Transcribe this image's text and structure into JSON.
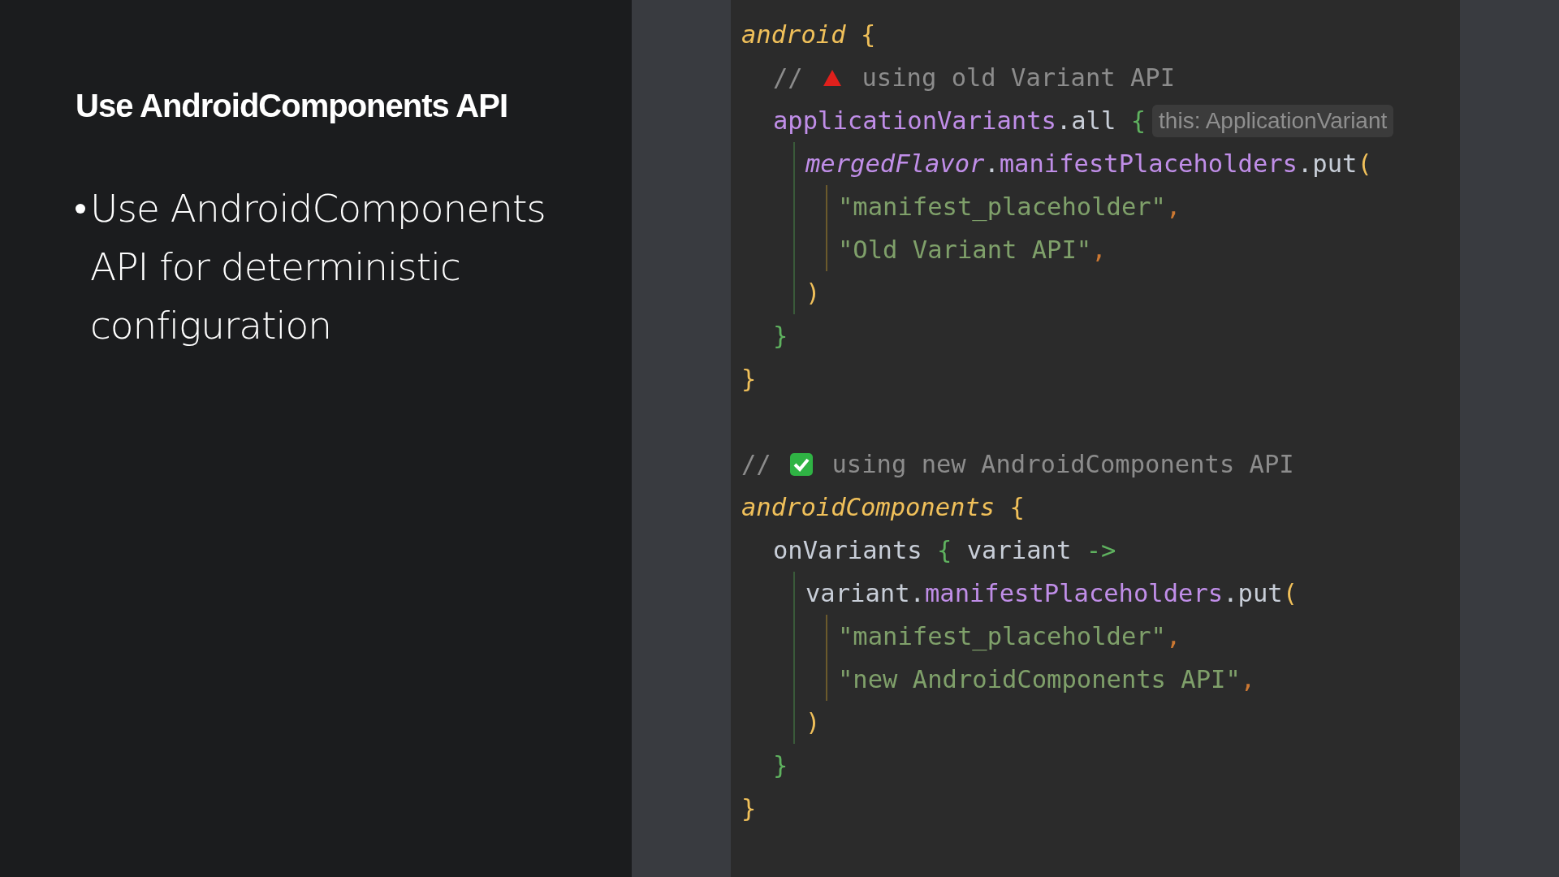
{
  "slide": {
    "title": "Use AndroidComponents API",
    "bullets": [
      "Use AndroidComponents API for deterministic configuration"
    ]
  },
  "code": {
    "blocks": [
      [
        {
          "tokens": [
            {
              "kind": "keyword",
              "text": "android"
            },
            {
              "kind": "brace",
              "text": " {"
            }
          ],
          "children": [
            {
              "tokens": [
                {
                  "kind": "comment",
                  "text": "// "
                },
                {
                  "kind": "triangle-icon"
                },
                {
                  "kind": "comment",
                  "text": " using old Variant API"
                }
              ]
            },
            {
              "tokens": [
                {
                  "kind": "property",
                  "text": "applicationVariants"
                },
                {
                  "kind": "plain",
                  "text": ".all "
                },
                {
                  "kind": "lambda",
                  "text": "{"
                },
                {
                  "kind": "hint",
                  "text": "this: ApplicationVariant"
                }
              ],
              "children": [
                {
                  "tokens": [
                    {
                      "kind": "italic-property",
                      "text": "mergedFlavor"
                    },
                    {
                      "kind": "plain",
                      "text": "."
                    },
                    {
                      "kind": "property",
                      "text": "manifestPlaceholders"
                    },
                    {
                      "kind": "plain",
                      "text": ".put"
                    },
                    {
                      "kind": "brace",
                      "text": "("
                    }
                  ],
                  "children": [
                    {
                      "tokens": [
                        {
                          "kind": "string",
                          "text": "\"manifest_placeholder\""
                        },
                        {
                          "kind": "comma",
                          "text": ","
                        }
                      ]
                    },
                    {
                      "tokens": [
                        {
                          "kind": "string",
                          "text": "\"Old Variant API\""
                        },
                        {
                          "kind": "comma",
                          "text": ","
                        }
                      ]
                    }
                  ]
                },
                {
                  "tokens": [
                    {
                      "kind": "brace",
                      "text": ")"
                    }
                  ]
                }
              ]
            },
            {
              "tokens": [
                {
                  "kind": "lambda",
                  "text": "}"
                }
              ]
            }
          ]
        },
        {
          "tokens": [
            {
              "kind": "brace",
              "text": "}"
            }
          ]
        }
      ],
      [
        {
          "tokens": [
            {
              "kind": "comment",
              "text": "// "
            },
            {
              "kind": "check-icon"
            },
            {
              "kind": "comment",
              "text": " using new AndroidComponents API"
            }
          ]
        },
        {
          "tokens": [
            {
              "kind": "keyword",
              "text": "androidComponents"
            },
            {
              "kind": "brace",
              "text": " {"
            }
          ],
          "children": [
            {
              "tokens": [
                {
                  "kind": "plain",
                  "text": "onVariants "
                },
                {
                  "kind": "lambda",
                  "text": "{"
                },
                {
                  "kind": "plain",
                  "text": " variant "
                },
                {
                  "kind": "lambda",
                  "text": "->"
                }
              ],
              "children": [
                {
                  "tokens": [
                    {
                      "kind": "plain",
                      "text": "variant."
                    },
                    {
                      "kind": "property",
                      "text": "manifestPlaceholders"
                    },
                    {
                      "kind": "plain",
                      "text": ".put"
                    },
                    {
                      "kind": "brace",
                      "text": "("
                    }
                  ],
                  "children": [
                    {
                      "tokens": [
                        {
                          "kind": "string",
                          "text": "\"manifest_placeholder\""
                        },
                        {
                          "kind": "comma",
                          "text": ","
                        }
                      ]
                    },
                    {
                      "tokens": [
                        {
                          "kind": "string",
                          "text": "\"new AndroidComponents API\""
                        },
                        {
                          "kind": "comma",
                          "text": ","
                        }
                      ]
                    }
                  ]
                },
                {
                  "tokens": [
                    {
                      "kind": "brace",
                      "text": ")"
                    }
                  ]
                }
              ]
            },
            {
              "tokens": [
                {
                  "kind": "lambda",
                  "text": "}"
                }
              ]
            }
          ]
        },
        {
          "tokens": [
            {
              "kind": "brace",
              "text": "}"
            }
          ]
        }
      ]
    ]
  }
}
